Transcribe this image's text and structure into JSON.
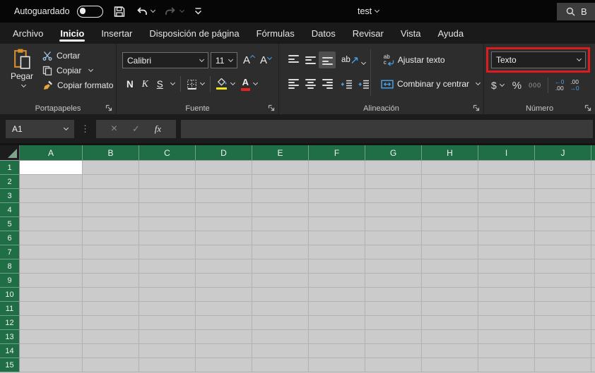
{
  "title_bar": {
    "autosave_label": "Autoguardado",
    "doc_title": "test",
    "search_text": "B"
  },
  "tabs": [
    {
      "label": "Archivo",
      "active": false
    },
    {
      "label": "Inicio",
      "active": true
    },
    {
      "label": "Insertar",
      "active": false
    },
    {
      "label": "Disposición de página",
      "active": false
    },
    {
      "label": "Fórmulas",
      "active": false
    },
    {
      "label": "Datos",
      "active": false
    },
    {
      "label": "Revisar",
      "active": false
    },
    {
      "label": "Vista",
      "active": false
    },
    {
      "label": "Ayuda",
      "active": false
    }
  ],
  "ribbon": {
    "clipboard": {
      "group_label": "Portapapeles",
      "paste": "Pegar",
      "cut": "Cortar",
      "copy": "Copiar",
      "format_painter": "Copiar formato"
    },
    "font": {
      "group_label": "Fuente",
      "font_name": "Calibri",
      "font_size": "11",
      "bold": "N",
      "italic": "K",
      "underline": "S",
      "grow": "A",
      "shrink": "A",
      "font_color_letter": "A"
    },
    "alignment": {
      "group_label": "Alineación",
      "orientation_glyph": "ab",
      "wrap_icon_top": "ab",
      "wrap_icon_bottom": "c",
      "wrap_text": "Ajustar texto",
      "merge_center": "Combinar y centrar"
    },
    "number": {
      "group_label": "Número",
      "format_selected": "Texto",
      "currency": "$",
      "percent": "%",
      "thousands": "000",
      "inc_dec_top": "←0",
      "inc_dec_bottom": ".00",
      "dec_dec_top": ".00",
      "dec_dec_bottom": "→0",
      "highlight_color": "#dd1c20"
    }
  },
  "formula_bar": {
    "name_box": "A1",
    "cancel": "×",
    "enter": "✓",
    "fx": "fx",
    "dots": "⋮",
    "formula_value": ""
  },
  "grid": {
    "columns": [
      "A",
      "B",
      "C",
      "D",
      "E",
      "F",
      "G",
      "H",
      "I",
      "J"
    ],
    "rows": [
      "1",
      "2",
      "3",
      "4",
      "5",
      "6",
      "7",
      "8",
      "9",
      "10",
      "11",
      "12",
      "13",
      "14",
      "15"
    ],
    "selected_cell": "A1"
  },
  "colors": {
    "header_green": "#1f6e45",
    "accent_blue": "#4aa0e8",
    "fill_yellow": "#f5e614",
    "font_red": "#e8211d",
    "annotation_red": "#dd1c20",
    "cell_gray": "#cbcbcb",
    "selection_white": "#ffffff"
  }
}
